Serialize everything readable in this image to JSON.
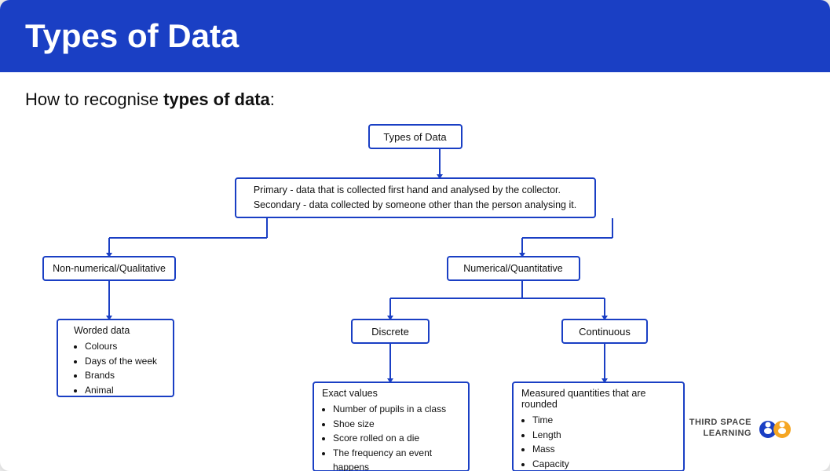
{
  "header": {
    "title": "Types of Data",
    "bg_color": "#1a3fc4"
  },
  "subtitle": {
    "prefix": "How to recognise ",
    "bold": "types of data",
    "suffix": ":"
  },
  "diagram": {
    "nodes": {
      "types_of_data": "Types of Data",
      "primary_secondary": "Primary - data that is collected first hand and analysed by the collector.\nSecondary - data collected by someone other than the person analysing it.",
      "non_numerical": "Non-numerical/Qualitative",
      "numerical": "Numerical/Quantitative",
      "worded_title": "Worded data",
      "worded_items": [
        "Colours",
        "Days of the week",
        "Brands",
        "Animal"
      ],
      "discrete": "Discrete",
      "continuous": "Continuous",
      "exact_title": "Exact values",
      "exact_items": [
        "Number of pupils in a class",
        "Shoe size",
        "Score rolled on a die",
        "The frequency an event happens"
      ],
      "measured_title": "Measured quantities that are rounded",
      "measured_items": [
        "Time",
        "Length",
        "Mass",
        "Capacity"
      ]
    }
  },
  "logo": {
    "line1": "THIRD SPACE",
    "line2": "LEARNING"
  }
}
